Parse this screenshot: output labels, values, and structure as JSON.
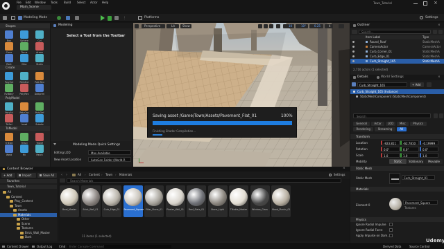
{
  "window": {
    "tab_title": "Main_Scene",
    "project_title": "Town_Tutorial",
    "menu": [
      "File",
      "Edit",
      "Window",
      "Tools",
      "Build",
      "Select",
      "Actor",
      "Help"
    ]
  },
  "toolbar": {
    "mode": "Modeling Mode",
    "platforms": "Platforms",
    "settings": "Settings"
  },
  "left_panel": {
    "sections": [
      {
        "name": "Shapes",
        "tools": [
          "Box",
          "Sphere",
          "Cyl",
          "Cone",
          "Torus",
          "Arrow",
          "Rect",
          "Disc",
          "Stairs"
        ]
      },
      {
        "name": "Create",
        "tools": [
          "PolyExt",
          "PathExt",
          "PathRev",
          "RvlBdry",
          "PolyRev",
          "Addprim"
        ]
      },
      {
        "name": "PolyModel",
        "tools": [
          "PolyEd",
          "PolyGrp",
          "PolyDef",
          "TriSel",
          "Inset",
          "Subdiv"
        ]
      },
      {
        "name": "TriModel",
        "tools": [
          "TriEdit",
          "TriSel",
          "TriDef",
          "Weld",
          "Fill",
          "Patch"
        ]
      }
    ]
  },
  "modeling_panel": {
    "tab": "Modeling",
    "message": "Select a Tool from the Toolbar",
    "settings_title": "Modeling Mode Quick Settings",
    "editing_lod_label": "Editing LOD",
    "editing_lod_value": "Max Available",
    "new_asset_label": "New Asset Location",
    "new_asset_value": "AutoGen Folder (World-R"
  },
  "viewport": {
    "view_mode": "Perspective",
    "lit_mode": "Lit",
    "show": "Show",
    "grid_value": "10",
    "angle_value": "10°",
    "scale_value": "0.25",
    "camera_speed": "4",
    "save_title": "Saving asset /Game/Town/Assets/Pavement_Flat_01",
    "save_percent": "100%",
    "save_progress": 1.0,
    "save_status": "Finishing Shader Compilation..."
  },
  "outliner": {
    "tab": "Outliner",
    "search_placeholder": "Search...",
    "col_label": "Item Label",
    "col_type": "Type",
    "rows": [
      {
        "label": "Round_Roof",
        "type": "StaticMeshA"
      },
      {
        "label": "CameraActor",
        "type": "CameraActor"
      },
      {
        "label": "Curb_Corner_01",
        "type": "StaticMeshA"
      },
      {
        "label": "Curb_Edge_01",
        "type": "StaticMeshA"
      },
      {
        "label": "Curb_Straight_165",
        "type": "StaticMeshA"
      }
    ],
    "status": "2,716 actors (1 selected)"
  },
  "details": {
    "tab_details": "Details",
    "tab_world": "World Settings",
    "actor_name": "Curb_Straight_165",
    "add_label": "+ Add",
    "instance_label": "Curb_Straight_165 (Instance)",
    "component_label": "StaticMeshComponent (StaticMeshComponent)",
    "search_placeholder": "Search",
    "filter_tabs_1": [
      "General",
      "Actor",
      "LOD",
      "Misc",
      "Physics"
    ],
    "filter_tabs_2": [
      "Rendering",
      "Streaming",
      "All"
    ],
    "transform_header": "Transform",
    "location_label": "Location",
    "location": [
      "-923.811",
      "-62.7810",
      "-0.19999"
    ],
    "rotation_label": "Rotation",
    "rotation": [
      "0.0°",
      "0.0°",
      "0.0°"
    ],
    "scale_label": "Scale",
    "scale": [
      "1.0",
      "1.0",
      "1.0"
    ],
    "mobility_label": "Mobility",
    "mobility": [
      "Static",
      "Stationary",
      "Movable"
    ],
    "static_mesh_header": "Static Mesh",
    "static_mesh_label": "Static Mesh",
    "static_mesh_value": "Curb_Straight_01",
    "materials_header": "Materials",
    "element_label": "Element 0",
    "element_value": "Pavement_Square",
    "element_value2": "Textures",
    "physics_header": "Physics",
    "physics_rows": [
      "Ignore Radial Impulse",
      "Ignore Radial Force",
      "Apply Impulse on Dam..."
    ]
  },
  "content_browser": {
    "tab": "Content Browser",
    "add_label": "+ Add",
    "import_label": "Import",
    "saveall_label": "Save All",
    "breadcrumb": [
      "All",
      "Content",
      "Town",
      "Materials"
    ],
    "settings": "Settings",
    "favorites": "Favorites",
    "project": "Town_Tutorial",
    "tree": [
      "All",
      "Content",
      "Play_Content",
      "Town",
      "Assets",
      "Materials",
      "Other",
      "Scene",
      "Textures",
      "Brick_Wall_Master",
      "Dark"
    ],
    "search_placeholder": "Search Materials",
    "assets": [
      {
        "name": "Bowl_Master",
        "color": "#cfc8b8"
      },
      {
        "name": "Brick_Wall_01",
        "color": "#8a8480"
      },
      {
        "name": "Curb_Edge_01",
        "color": "#b9b4aa"
      },
      {
        "name": "Pavement_Square",
        "color": "#c9c4bb"
      },
      {
        "name": "Pillar_Stone_01",
        "color": "#a8a49c"
      },
      {
        "name": "Plaster_Wall_01",
        "color": "#d8d4cc"
      },
      {
        "name": "Roof_Slate_01",
        "color": "#6e7076"
      },
      {
        "name": "Stone_Light",
        "color": "#8c8780"
      },
      {
        "name": "Tiltable_Master",
        "color": "#e2ddd2"
      },
      {
        "name": "Window_Glass",
        "color": "#484848"
      },
      {
        "name": "Wood_Planks_01",
        "color": "#b8b0a2"
      }
    ],
    "selected_index": 3,
    "status": "11 items (1 selected)"
  },
  "statusbar": {
    "content_drawer": "Content Drawer",
    "output_log": "Output Log",
    "cmd": "Cmd",
    "console_placeholder": "Enter Console Command",
    "derived_data": "Derived Data",
    "source_control": "Source Control"
  },
  "watermark": "Udemy"
}
